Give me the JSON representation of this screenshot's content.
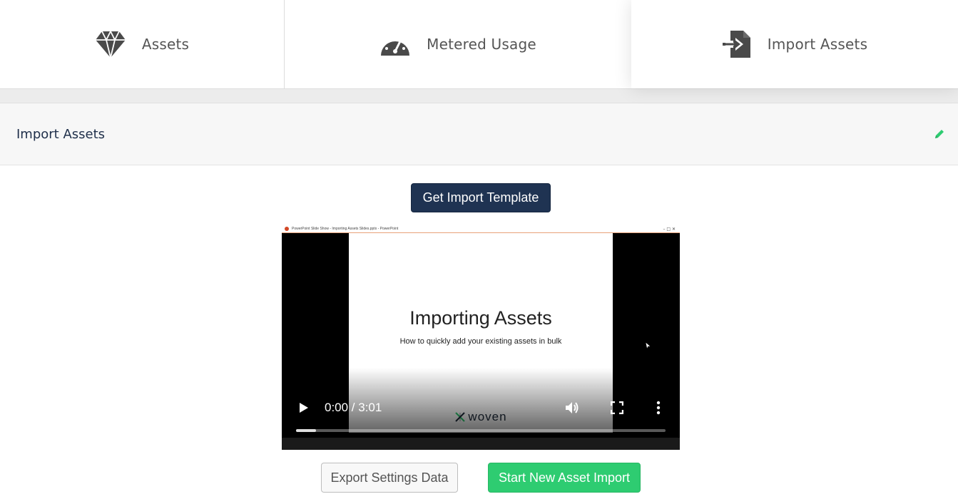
{
  "tabs": [
    {
      "label": "Assets",
      "icon": "diamond-icon"
    },
    {
      "label": "Metered Usage",
      "icon": "gauge-icon"
    },
    {
      "label": "Import Assets",
      "icon": "file-import-icon",
      "active": true
    }
  ],
  "section": {
    "title": "Import Assets",
    "edit_icon": "pencil-icon"
  },
  "buttons": {
    "get_template": "Get Import Template",
    "export_settings": "Export Settings Data",
    "start_import": "Start New Asset Import"
  },
  "video": {
    "window_title": "PowerPoint Slide Show - Importing Assets Slides.pptx - PowerPoint",
    "slide_title": "Importing Assets",
    "slide_subtitle": "How to quickly add your existing assets in bulk",
    "brand": "woven",
    "time": "0:00 / 3:01",
    "buffered": 0.055
  },
  "colors": {
    "navy": "#1f3352",
    "green": "#2ecc71",
    "tab_icon": "#4a4a4a",
    "edit_icon": "#2ecc71"
  }
}
